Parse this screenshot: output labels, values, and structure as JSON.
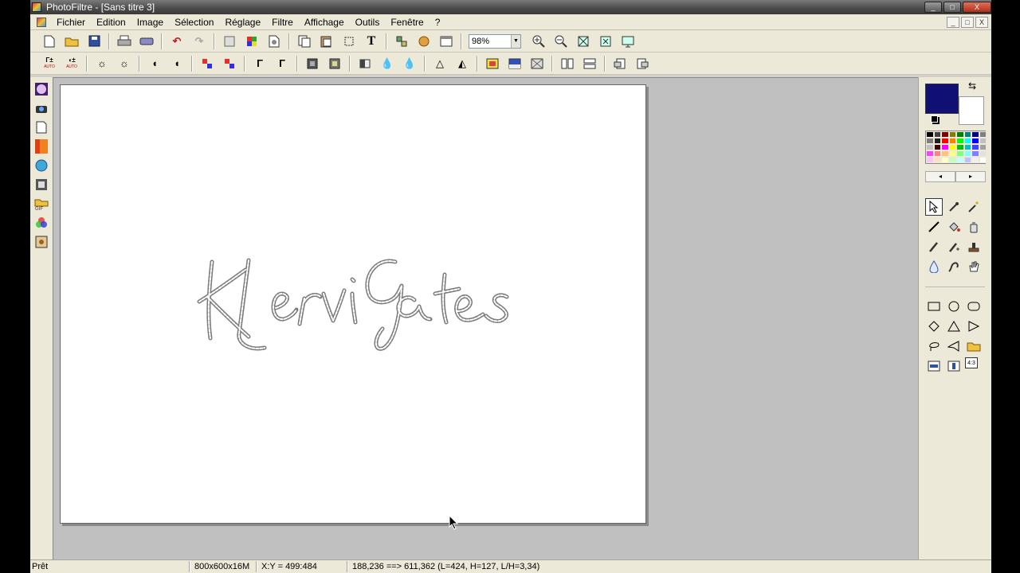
{
  "window": {
    "title": "PhotoFiltre - [Sans titre 3]",
    "controls": [
      "_",
      "□",
      "X"
    ]
  },
  "menu": {
    "items": [
      "Fichier",
      "Edition",
      "Image",
      "Sélection",
      "Réglage",
      "Filtre",
      "Affichage",
      "Outils",
      "Fenêtre",
      "?"
    ]
  },
  "toolbar1": {
    "zoom": "98%",
    "icons": [
      "new-icon",
      "open-icon",
      "save-icon",
      "print-icon",
      "scan-icon",
      "undo-icon",
      "redo-icon",
      "mask-icon",
      "color-grid-icon",
      "transparency-icon",
      "copy-icon",
      "paste-icon",
      "crop-icon",
      "text-icon",
      "plugin-icon",
      "automation-icon",
      "window-icon",
      "zoom-in-icon",
      "zoom-out-icon",
      "fit-icon",
      "actual-size-icon",
      "fullscreen-icon"
    ]
  },
  "toolbar2": {
    "auto_label": "AUTO",
    "icons": [
      "levels-auto-icon",
      "contrast-auto-icon",
      "brightness-down-icon",
      "brightness-up-icon",
      "contrast-down-icon",
      "contrast-up-icon",
      "saturation-down-icon",
      "saturation-up-icon",
      "gamma-down-icon",
      "gamma-up-icon",
      "blur-icon",
      "sharpen-icon",
      "grayscale-icon",
      "drop-icon",
      "drop-more-icon",
      "triangle-icon",
      "triangle-more-icon",
      "gradient-icon",
      "fade-icon",
      "texture-icon",
      "flip-h-icon",
      "flip-v-icon",
      "rotate-left-icon",
      "rotate-right-icon"
    ]
  },
  "canvas": {
    "text": "KlerviGates",
    "colors": {
      "stroke": "#7c7c7c",
      "fill": "#ffffff"
    }
  },
  "colors": {
    "foreground": "#0f0f74",
    "background": "#ffffff",
    "palette": [
      "#000000",
      "#404040",
      "#800000",
      "#808000",
      "#008000",
      "#008080",
      "#000080",
      "#808080",
      "#808080",
      "#202020",
      "#ff0000",
      "#ff8000",
      "#00ff00",
      "#00ffff",
      "#0000ff",
      "#c0c0c0",
      "#c0c0c0",
      "#400000",
      "#ff00ff",
      "#ffff00",
      "#00c000",
      "#00c0c0",
      "#4040ff",
      "#a0a0a0",
      "#ff40ff",
      "#ff8080",
      "#ffc080",
      "#ffff80",
      "#80ff80",
      "#80ffff",
      "#8080ff",
      "#e0e0e0",
      "#ffc0ff",
      "#ffe0c0",
      "#ffffc0",
      "#c0ffc0",
      "#c0ffff",
      "#c0c0ff",
      "#f0f0f0",
      "#ffffff"
    ]
  },
  "tools": [
    "selection-icon",
    "eyedropper-icon",
    "magic-wand-icon",
    "line-icon",
    "fill-icon",
    "spray-icon",
    "brush-icon",
    "advanced-brush-icon",
    "stamp-icon",
    "blur-drop-icon",
    "smudge-icon",
    "hand-icon",
    "rectangle-icon",
    "ellipse-icon",
    "rounded-rect-icon",
    "diamond-icon",
    "triangle-icon",
    "arrow-icon",
    "lasso-icon",
    "polygon-icon",
    "open-selection-icon",
    "align-h-icon",
    "align-v-icon",
    "ratio-icon"
  ],
  "tool_labels": {
    "ratio": "4:3"
  },
  "status": {
    "state": "Prêt",
    "image_size": "800x600x16M",
    "coords": "X:Y = 499:484",
    "selection": "188,236 ==> 611,362 (L=424, H=127, L/H=3,34)"
  }
}
